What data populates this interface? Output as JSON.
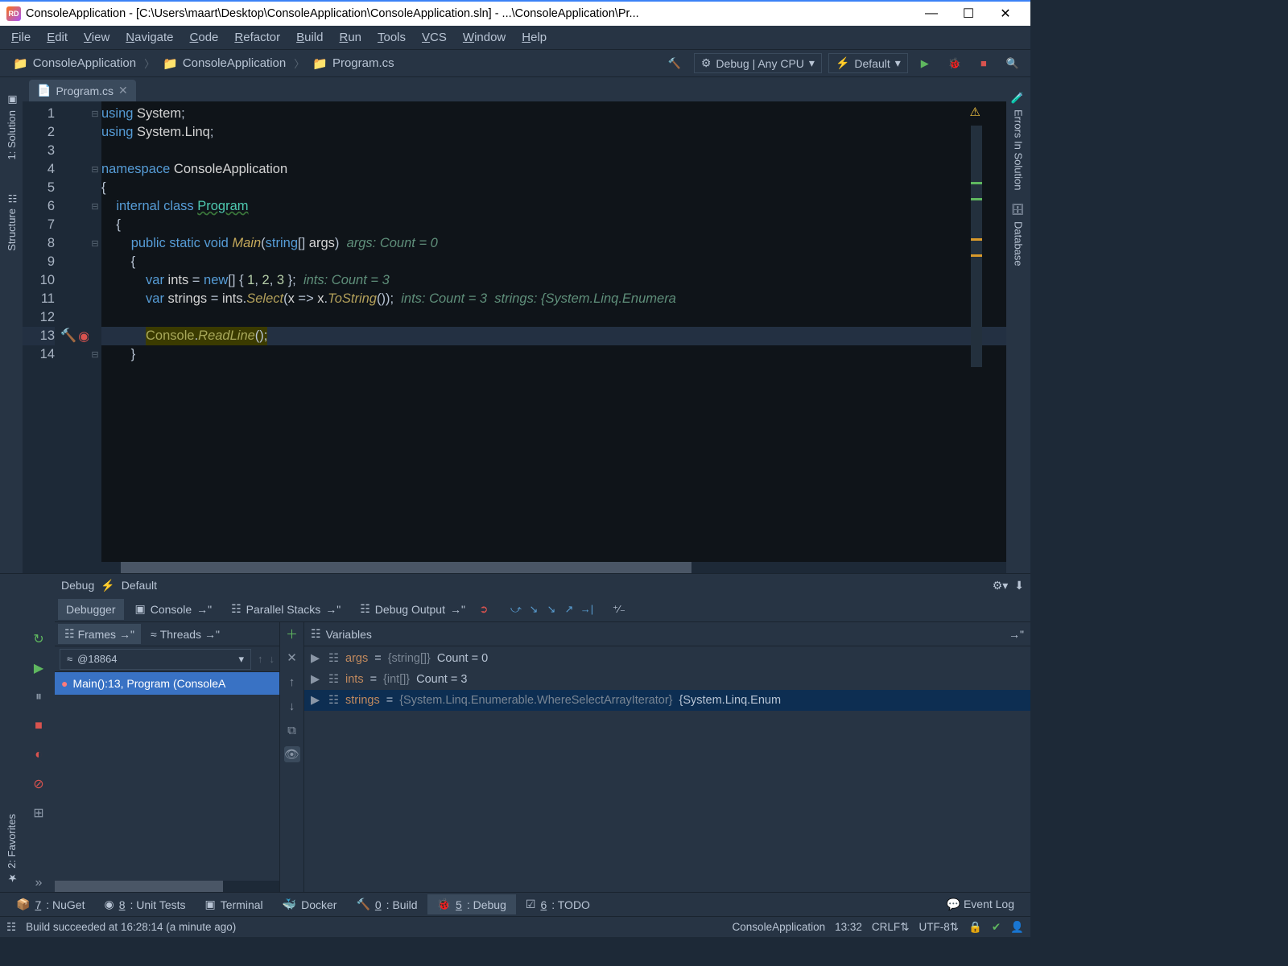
{
  "title": "ConsoleApplication - [C:\\Users\\maart\\Desktop\\ConsoleApplication\\ConsoleApplication.sln] - ...\\ConsoleApplication\\Pr...",
  "menu": [
    "File",
    "Edit",
    "View",
    "Navigate",
    "Code",
    "Refactor",
    "Build",
    "Run",
    "Tools",
    "VCS",
    "Window",
    "Help"
  ],
  "breadcrumbs": [
    "ConsoleApplication",
    "ConsoleApplication",
    "Program.cs"
  ],
  "config_debug": "Debug | Any CPU",
  "config_run": "Default",
  "tab_name": "Program.cs",
  "left_tools": [
    "1: Solution",
    "Structure"
  ],
  "right_tools": [
    "Errors In Solution",
    "Database"
  ],
  "code_lines": [
    {
      "n": 1,
      "html": "<span class='kw'>using</span> <span class='ident'>System</span>;"
    },
    {
      "n": 2,
      "html": "<span class='kw'>using</span> <span class='ident'>System.Linq</span>;"
    },
    {
      "n": 3,
      "html": ""
    },
    {
      "n": 4,
      "html": "<span class='kw'>namespace</span> <span class='ident'>ConsoleApplication</span>"
    },
    {
      "n": 5,
      "html": "{"
    },
    {
      "n": 6,
      "html": "    <span class='kw'>internal</span> <span class='kw'>class</span> <span class='type' style='text-decoration:underline wavy #3c7a3c'>Program</span>"
    },
    {
      "n": 7,
      "html": "    {"
    },
    {
      "n": 8,
      "html": "        <span class='kw'>public</span> <span class='kw'>static</span> <span class='kw'>void</span> <span class='fn' style='color:#c4a85a'>Main</span>(<span class='kw'>string</span>[] <span class='ident'>args</span>)  <span class='comment'>args: Count = 0</span>"
    },
    {
      "n": 9,
      "html": "        {"
    },
    {
      "n": 10,
      "html": "            <span class='kw'>var</span> <span class='ident'>ints</span> = <span class='kw'>new</span>[] { <span class='num'>1</span>, <span class='num'>2</span>, <span class='num'>3</span> };  <span class='comment'>ints: Count = 3</span>"
    },
    {
      "n": 11,
      "html": "            <span class='kw'>var</span> <span class='ident'>strings</span> = <span class='ident'>ints</span>.<span class='fn'>Select</span>(<span class='ident'>x</span> =&gt; <span class='ident'>x</span>.<span class='fn'>ToString</span>());  <span class='comment'>ints: Count = 3  strings: {System.Linq.Enumera</span>"
    },
    {
      "n": 12,
      "html": ""
    },
    {
      "n": 13,
      "html": "            <span class='exec'><span class='ident' style='color:#a8a85a'>Console</span>.<span class='fn' style='color:#a8a85a'>ReadLine</span>();</span>",
      "hl": true
    },
    {
      "n": 14,
      "html": "        }"
    }
  ],
  "debug": {
    "title_label": "Debug",
    "config_label": "Default",
    "tabs": [
      "Debugger",
      "Console",
      "Parallel Stacks",
      "Debug Output"
    ],
    "frames_tabs": [
      "Frames",
      "Threads"
    ],
    "thread": "@18864",
    "frame": "Main():13, Program (ConsoleA",
    "vars_label": "Variables",
    "vars": [
      {
        "name": "args",
        "type": "{string[]}",
        "val": "Count = 0"
      },
      {
        "name": "ints",
        "type": "{int[]}",
        "val": "Count = 3"
      },
      {
        "name": "strings",
        "type": "{System.Linq.Enumerable.WhereSelectArrayIterator<int,string>}",
        "val": "{System.Linq.Enum",
        "sel": true
      }
    ]
  },
  "bottom": [
    {
      "icon": "📦",
      "label": "7: NuGet",
      "u": "7"
    },
    {
      "icon": "◉",
      "label": "8: Unit Tests",
      "u": "8"
    },
    {
      "icon": "▣",
      "label": "Terminal"
    },
    {
      "icon": "🐳",
      "label": "Docker"
    },
    {
      "icon": "🔨",
      "label": "0: Build",
      "u": "0"
    },
    {
      "icon": "🐞",
      "label": "5: Debug",
      "u": "5",
      "active": true
    },
    {
      "icon": "☑",
      "label": "6: TODO",
      "u": "6"
    }
  ],
  "event_log": "Event Log",
  "status": {
    "msg": "Build succeeded at 16:28:14 (a minute ago)",
    "app": "ConsoleApplication",
    "pos": "13:32",
    "le": "CRLF",
    "enc": "UTF-8"
  }
}
